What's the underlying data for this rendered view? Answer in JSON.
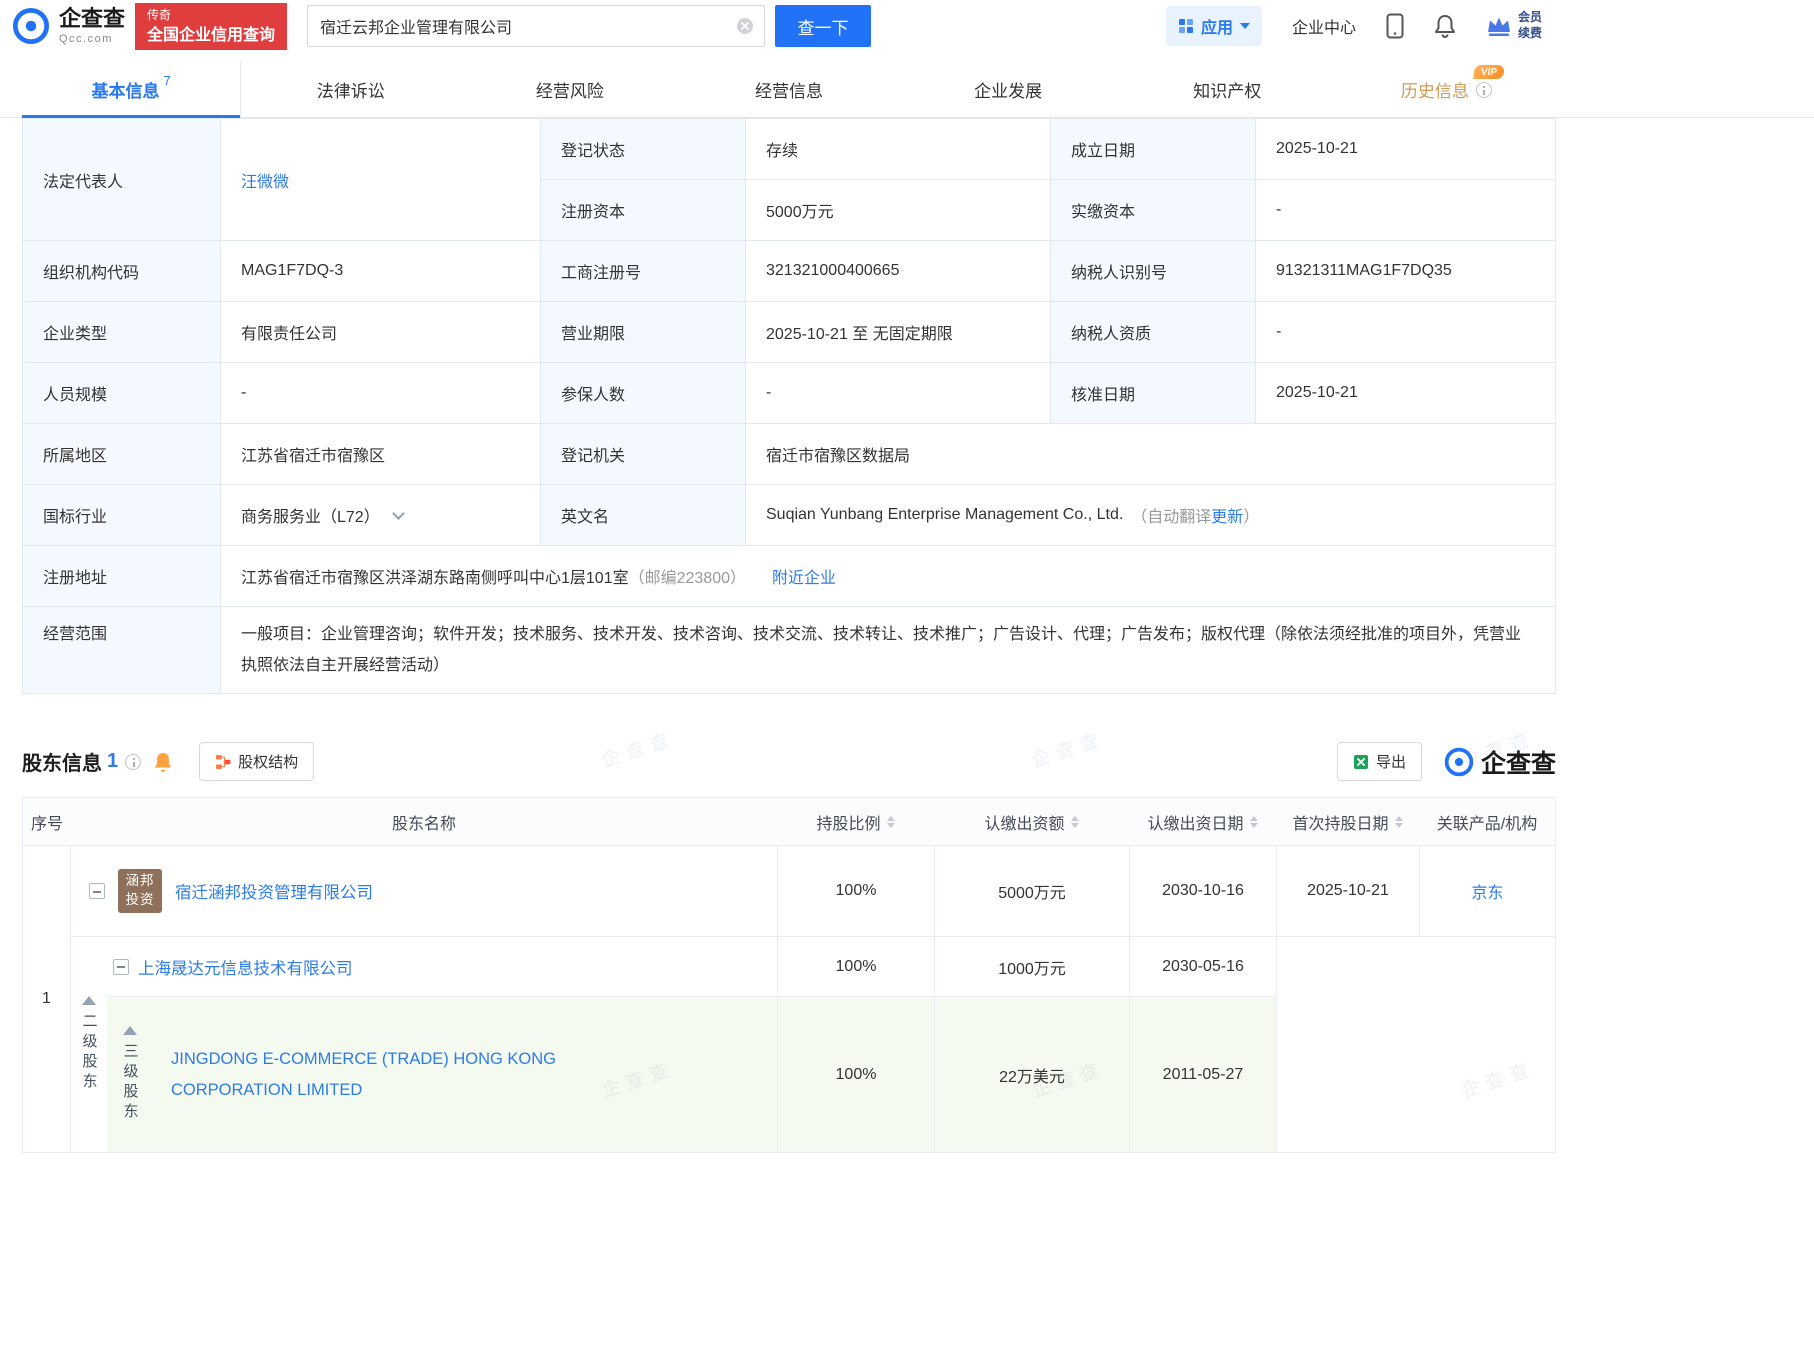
{
  "watermark": "企查查",
  "colors": {
    "accent_blue": "#2878f0",
    "link_blue": "#2d7ce5",
    "badge_red": "#e03e3e",
    "vip_orange": "#ff8b1e",
    "level3_row_bg": "#f5faf0"
  },
  "header": {
    "logo": {
      "name": "企查查",
      "domain": "Qcc.com"
    },
    "promo": {
      "line1": "传奇",
      "line2": "全国企业信用查询"
    },
    "search": {
      "value": "宿迁云邦企业管理有限公司",
      "button": "查一下"
    },
    "nav": {
      "apps": "应用",
      "enterprise_center": "企业中心",
      "member_line1": "会员",
      "member_line2": "续费"
    }
  },
  "tabs": [
    {
      "label": "基本信息",
      "count": "7"
    },
    {
      "label": "法律诉讼"
    },
    {
      "label": "经营风险"
    },
    {
      "label": "经营信息"
    },
    {
      "label": "企业发展"
    },
    {
      "label": "知识产权"
    },
    {
      "label": "历史信息",
      "badge": "VIP"
    }
  ],
  "basic_info": {
    "legal_rep": {
      "label": "法定代表人",
      "value": "汪微微"
    },
    "reg_status": {
      "label": "登记状态",
      "value": "存续"
    },
    "establish_date": {
      "label": "成立日期",
      "value": "2025-10-21"
    },
    "reg_capital": {
      "label": "注册资本",
      "value": "5000万元"
    },
    "paid_capital": {
      "label": "实缴资本",
      "value": "-"
    },
    "org_code": {
      "label": "组织机构代码",
      "value": "MAG1F7DQ-3"
    },
    "biz_reg_no": {
      "label": "工商注册号",
      "value": "321321000400665"
    },
    "taxpayer_id": {
      "label": "纳税人识别号",
      "value": "91321311MAG1F7DQ35"
    },
    "company_type": {
      "label": "企业类型",
      "value": "有限责任公司"
    },
    "biz_term": {
      "label": "营业期限",
      "value": "2025-10-21 至 无固定期限"
    },
    "taxpayer_quality": {
      "label": "纳税人资质",
      "value": "-"
    },
    "staff_size": {
      "label": "人员规模",
      "value": "-"
    },
    "insured_count": {
      "label": "参保人数",
      "value": "-"
    },
    "approval_date": {
      "label": "核准日期",
      "value": "2025-10-21"
    },
    "region": {
      "label": "所属地区",
      "value": "江苏省宿迁市宿豫区"
    },
    "reg_authority": {
      "label": "登记机关",
      "value": "宿迁市宿豫区数据局"
    },
    "industry": {
      "label": "国标行业",
      "value": "商务服务业（L72）"
    },
    "english_name": {
      "label": "英文名",
      "value": "Suqian Yunbang Enterprise Management Co., Ltd.",
      "note_prefix": "（自动翻译",
      "note_link": "更新",
      "note_suffix": "）"
    },
    "address": {
      "label": "注册地址",
      "value": "江苏省宿迁市宿豫区洪泽湖东路南侧呼叫中心1层101室",
      "postal": "（邮编223800）",
      "nearby": "附近企业"
    },
    "biz_scope": {
      "label": "经营范围",
      "value": "一般项目：企业管理咨询；软件开发；技术服务、技术开发、技术咨询、技术交流、技术转让、技术推广；广告设计、代理；广告发布；版权代理（除依法须经批准的项目外，凭营业执照依法自主开展经营活动）"
    }
  },
  "shareholders": {
    "title": "股东信息",
    "count": "1",
    "equity_button": "股权结构",
    "export_button": "导出",
    "logo_text": "企查查",
    "table": {
      "headers": [
        "序号",
        "股东名称",
        "持股比例",
        "认缴出资额",
        "认缴出资日期",
        "首次持股日期",
        "关联产品/机构"
      ],
      "group_no": "1",
      "level2_label": "二级股东",
      "level3_label": "三级股东",
      "rows": [
        {
          "name": "宿迁涵邦投资管理有限公司",
          "avatar_line1": "涵邦",
          "avatar_line2": "投资",
          "ratio": "100%",
          "amount": "5000万元",
          "amount_date": "2030-10-16",
          "first_date": "2025-10-21",
          "related": "京东"
        },
        {
          "name": "上海晟达元信息技术有限公司",
          "ratio": "100%",
          "amount": "1000万元",
          "amount_date": "2030-05-16"
        },
        {
          "name": "JINGDONG E-COMMERCE (TRADE) HONG KONG CORPORATION LIMITED",
          "ratio": "100%",
          "amount": "22万美元",
          "amount_date": "2011-05-27"
        }
      ]
    }
  }
}
